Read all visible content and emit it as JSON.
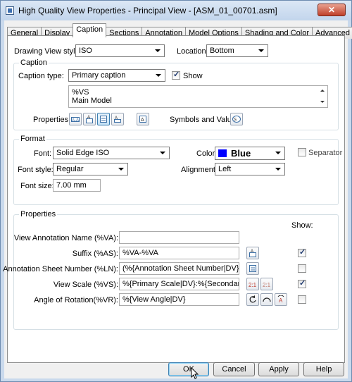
{
  "window": {
    "title": "High Quality View Properties - Principal View - [ASM_01_00701.asm]",
    "close_label": "✕"
  },
  "tabs": [
    {
      "label": "General"
    },
    {
      "label": "Display"
    },
    {
      "label": "Caption"
    },
    {
      "label": "Sections"
    },
    {
      "label": "Annotation"
    },
    {
      "label": "Model Options"
    },
    {
      "label": "Shading and Color"
    },
    {
      "label": "Advanced"
    }
  ],
  "top": {
    "style_label": "Drawing View style:",
    "style_value": "ISO",
    "location_label": "Location:",
    "location_value": "Bottom"
  },
  "caption": {
    "group_title": "Caption",
    "type_label": "Caption type:",
    "type_value": "Primary caption",
    "show_label": "Show",
    "show_checked": true,
    "text_line1": "%VS",
    "text_line2": "Main Model",
    "properties_label": "Properties:",
    "symbols_label": "Symbols and Values:"
  },
  "format": {
    "group_title": "Format",
    "font_label": "Font:",
    "font_value": "Solid Edge ISO",
    "color_label": "Color:",
    "color_value": "Blue",
    "color_hex": "#0000ff",
    "separator_label": "Separator",
    "font_style_label": "Font style:",
    "font_style_value": "Regular",
    "alignment_label": "Alignment:",
    "alignment_value": "Left",
    "font_size_label": "Font size:",
    "font_size_value": "7.00 mm"
  },
  "properties": {
    "group_title": "Properties",
    "show_header": "Show:",
    "rows": [
      {
        "label": "View Annotation Name (%VA):",
        "value": "",
        "show": null
      },
      {
        "label": "Suffix (%AS):",
        "value": "%VA-%VA",
        "show": true
      },
      {
        "label": "Annotation Sheet Number (%LN):",
        "value": "(%{Annotation Sheet Number|DV})",
        "show": false
      },
      {
        "label": "View Scale (%VS):",
        "value": "%{Primary Scale|DV}:%{Secondary Scale|DV",
        "show": true
      },
      {
        "label": "Angle of Rotation(%VR):",
        "value": "%{View Angle|DV}",
        "show": false
      }
    ]
  },
  "buttons": {
    "ok": "OK",
    "cancel": "Cancel",
    "apply": "Apply",
    "help": "Help"
  }
}
